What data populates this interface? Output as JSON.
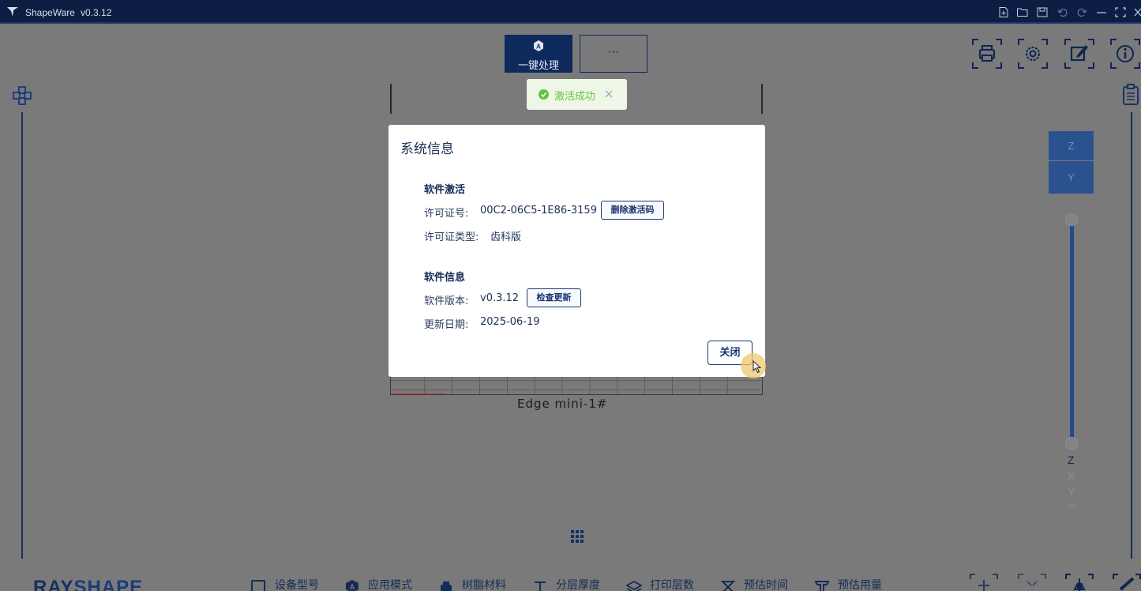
{
  "titlebar": {
    "app_name": "ShapeWare",
    "version": "v0.3.12",
    "icons": [
      "new-file-icon",
      "open-folder-icon",
      "save-icon",
      "undo-icon",
      "redo-icon",
      "minimize-icon",
      "maximize-icon",
      "close-icon"
    ]
  },
  "toolbar": {
    "one_click_label": "一键处理",
    "more_label": "···"
  },
  "right_tools": [
    "print-icon",
    "settings-icon",
    "edit-icon",
    "info-icon"
  ],
  "view_buttons": {
    "z": "Z",
    "y": "Y"
  },
  "axis_labels": {
    "z": "Z",
    "x": "X",
    "y": "Y",
    "cut": "✂"
  },
  "printer_name": "Edge mini-1#",
  "toast": {
    "message": "激活成功"
  },
  "modal": {
    "title": "系统信息",
    "activation": {
      "heading": "软件激活",
      "license_label": "许可证号:",
      "license_value": "00C2-06C5-1E86-3159",
      "delete_button": "删除激活码",
      "type_label": "许可证类型:",
      "type_value": "齿科版"
    },
    "info": {
      "heading": "软件信息",
      "version_label": "软件版本:",
      "version_value": "v0.3.12",
      "check_button": "检查更新",
      "date_label": "更新日期:",
      "date_value": "2025-06-19"
    },
    "close_button": "关闭"
  },
  "bottom_bar": {
    "brand_part1": "RAY",
    "brand_part2": "SHAPE",
    "items": [
      {
        "label": "设备型号",
        "icon": "device-icon"
      },
      {
        "label": "应用模式",
        "icon": "mode-icon"
      },
      {
        "label": "树脂材料",
        "icon": "resin-icon"
      },
      {
        "label": "分层厚度",
        "icon": "layer-thickness-icon"
      },
      {
        "label": "打印层数",
        "icon": "layers-icon"
      },
      {
        "label": "预估时间",
        "icon": "hourglass-icon"
      },
      {
        "label": "预估用量",
        "icon": "usage-icon"
      }
    ]
  },
  "colors": {
    "titlebar_bg": "#0c1e44",
    "primary": "#0e2a5c",
    "toast_success": "#67c23a",
    "workspace": "#7a7a7a"
  }
}
